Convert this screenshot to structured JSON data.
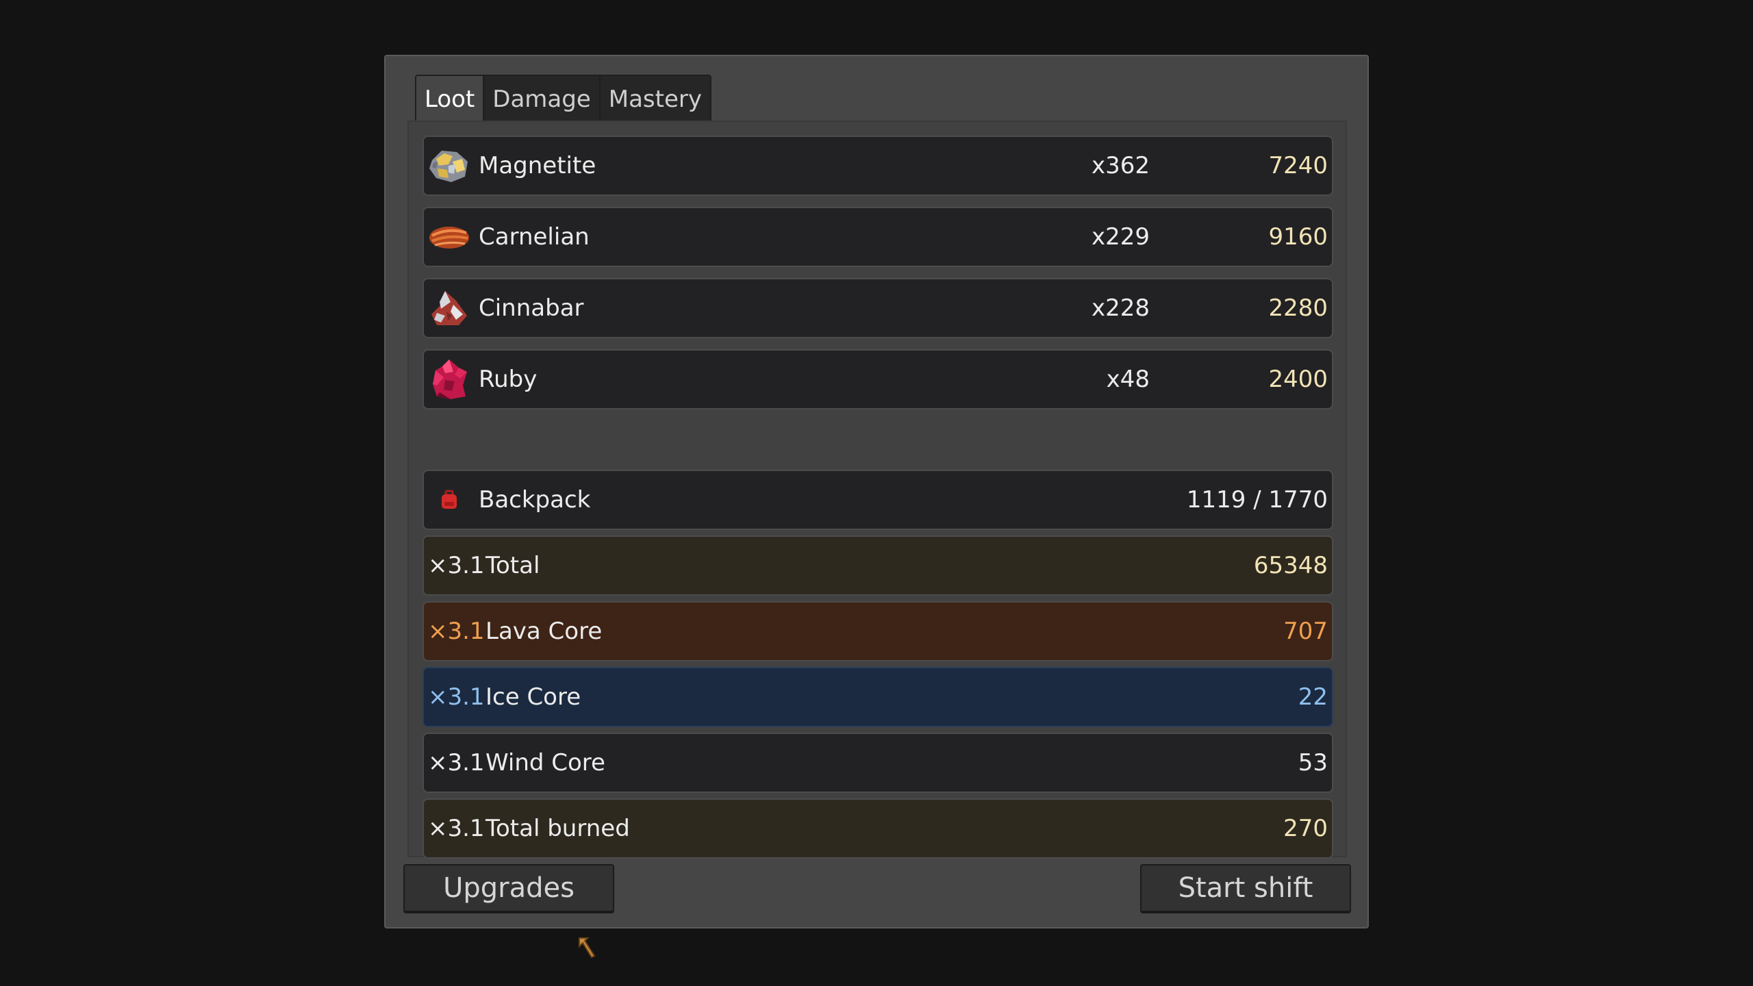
{
  "tabs": [
    {
      "label": "Loot",
      "active": true
    },
    {
      "label": "Damage",
      "active": false
    },
    {
      "label": "Mastery",
      "active": false
    }
  ],
  "loot": [
    {
      "name": "Magnetite",
      "count": "x362",
      "value": "7240",
      "icon": "magnetite-ore-icon"
    },
    {
      "name": "Carnelian",
      "count": "x229",
      "value": "9160",
      "icon": "carnelian-ore-icon"
    },
    {
      "name": "Cinnabar",
      "count": "x228",
      "value": "2280",
      "icon": "cinnabar-ore-icon"
    },
    {
      "name": "Ruby",
      "count": "x48",
      "value": "2400",
      "icon": "ruby-gem-icon"
    }
  ],
  "backpack": {
    "label": "Backpack",
    "value": "1119 / 1770",
    "icon": "backpack-icon"
  },
  "totals": {
    "total": {
      "mult": "×3.1",
      "label": "Total",
      "value": "65348"
    },
    "lava": {
      "mult": "×3.1",
      "label": "Lava Core",
      "value": "707"
    },
    "ice": {
      "mult": "×3.1",
      "label": "Ice Core",
      "value": "22"
    },
    "wind": {
      "mult": "×3.1",
      "label": "Wind Core",
      "value": "53"
    },
    "burned": {
      "mult": "×3.1",
      "label": "Total burned",
      "value": "270"
    }
  },
  "buttons": {
    "upgrades": "Upgrades",
    "start_shift": "Start shift"
  },
  "colors": {
    "gold_text": "#f2e4b6",
    "lava_text": "#f0a050",
    "ice_text": "#8fbfee"
  }
}
